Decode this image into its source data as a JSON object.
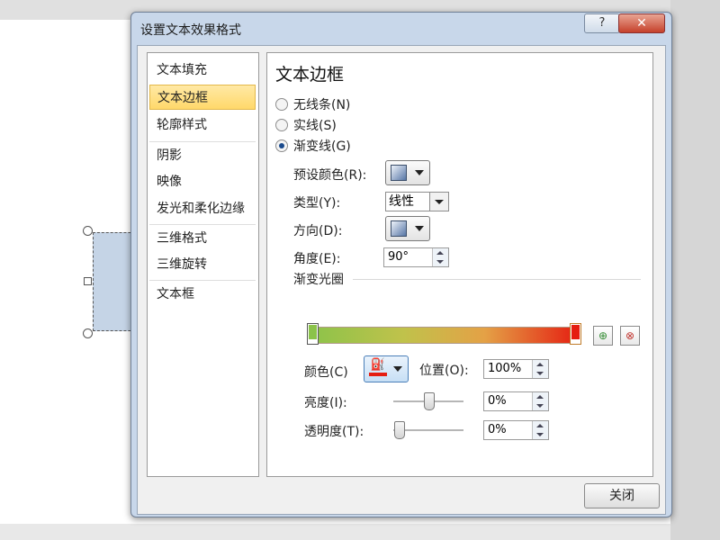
{
  "dialog": {
    "title": "设置文本效果格式",
    "help_label": "?",
    "close_label": "✕",
    "close_button_label": "关闭"
  },
  "nav": {
    "items": [
      {
        "label": "文本填充",
        "selected": false
      },
      {
        "label": "文本边框",
        "selected": true
      },
      {
        "label": "轮廓样式",
        "selected": false
      },
      {
        "label": "阴影",
        "selected": false
      },
      {
        "label": "映像",
        "selected": false
      },
      {
        "label": "发光和柔化边缘",
        "selected": false
      },
      {
        "label": "三维格式",
        "selected": false
      },
      {
        "label": "三维旋转",
        "selected": false
      },
      {
        "label": "文本框",
        "selected": false
      }
    ]
  },
  "panel": {
    "heading": "文本边框",
    "line_options": [
      {
        "label": "无线条(N)",
        "checked": false
      },
      {
        "label": "实线(S)",
        "checked": false
      },
      {
        "label": "渐变线(G)",
        "checked": true
      }
    ],
    "preset_colors_label": "预设颜色(R):",
    "type_label": "类型(Y):",
    "type_value": "线性",
    "direction_label": "方向(D):",
    "angle_label": "角度(E):",
    "angle_value": "90°",
    "gradient_stops_label": "渐变光圈",
    "gradient_stops": [
      {
        "position_percent": 0,
        "color": "#8bc34a"
      },
      {
        "position_percent": 100,
        "color": "#e51d11"
      }
    ],
    "color_label": "颜色(C)",
    "color_value": "#e51d11",
    "position_label": "位置(O):",
    "position_value": "100%",
    "brightness_label": "亮度(I):",
    "brightness_value": "0%",
    "transparency_label": "透明度(T):",
    "transparency_value": "0%",
    "brightness_level": 0,
    "transparency_level": 0
  }
}
